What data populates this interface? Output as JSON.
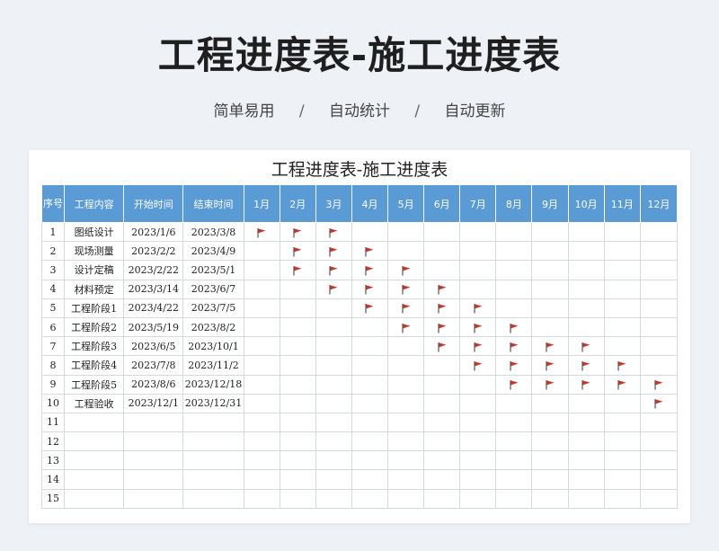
{
  "hero_title": "工程进度表-施工进度表",
  "subtitle": {
    "items": [
      "简单易用",
      "自动统计",
      "自动更新"
    ],
    "separator": "/"
  },
  "sheet": {
    "title": "工程进度表-施工进度表",
    "headers": [
      "序号",
      "工程内容",
      "开始时间",
      "结束时间",
      "1月",
      "2月",
      "3月",
      "4月",
      "5月",
      "6月",
      "7月",
      "8月",
      "9月",
      "10月",
      "11月",
      "12月"
    ],
    "flag_icon": "red-flag-icon",
    "flag_color": "#c0392b",
    "header_color": "#5b9bd5",
    "rows": [
      {
        "no": "1",
        "task": "图纸设计",
        "start": "2023/1/6",
        "end": "2023/3/8",
        "months": [
          1,
          2,
          3
        ]
      },
      {
        "no": "2",
        "task": "现场测量",
        "start": "2023/2/2",
        "end": "2023/4/9",
        "months": [
          2,
          3,
          4
        ]
      },
      {
        "no": "3",
        "task": "设计定稿",
        "start": "2023/2/22",
        "end": "2023/5/1",
        "months": [
          2,
          3,
          4,
          5
        ]
      },
      {
        "no": "4",
        "task": "材料预定",
        "start": "2023/3/14",
        "end": "2023/6/7",
        "months": [
          3,
          4,
          5,
          6
        ]
      },
      {
        "no": "5",
        "task": "工程阶段1",
        "start": "2023/4/22",
        "end": "2023/7/5",
        "months": [
          4,
          5,
          6,
          7
        ]
      },
      {
        "no": "6",
        "task": "工程阶段2",
        "start": "2023/5/19",
        "end": "2023/8/2",
        "months": [
          5,
          6,
          7,
          8
        ]
      },
      {
        "no": "7",
        "task": "工程阶段3",
        "start": "2023/6/5",
        "end": "2023/10/1",
        "months": [
          6,
          7,
          8,
          9,
          10
        ]
      },
      {
        "no": "8",
        "task": "工程阶段4",
        "start": "2023/7/8",
        "end": "2023/11/2",
        "months": [
          7,
          8,
          9,
          10,
          11
        ]
      },
      {
        "no": "9",
        "task": "工程阶段5",
        "start": "2023/8/6",
        "end": "2023/12/18",
        "months": [
          8,
          9,
          10,
          11,
          12
        ]
      },
      {
        "no": "10",
        "task": "工程验收",
        "start": "2023/12/1",
        "end": "2023/12/31",
        "months": [
          12
        ]
      },
      {
        "no": "11",
        "task": "",
        "start": "",
        "end": "",
        "months": []
      },
      {
        "no": "12",
        "task": "",
        "start": "",
        "end": "",
        "months": []
      },
      {
        "no": "13",
        "task": "",
        "start": "",
        "end": "",
        "months": []
      },
      {
        "no": "14",
        "task": "",
        "start": "",
        "end": "",
        "months": []
      },
      {
        "no": "15",
        "task": "",
        "start": "",
        "end": "",
        "months": []
      }
    ]
  }
}
